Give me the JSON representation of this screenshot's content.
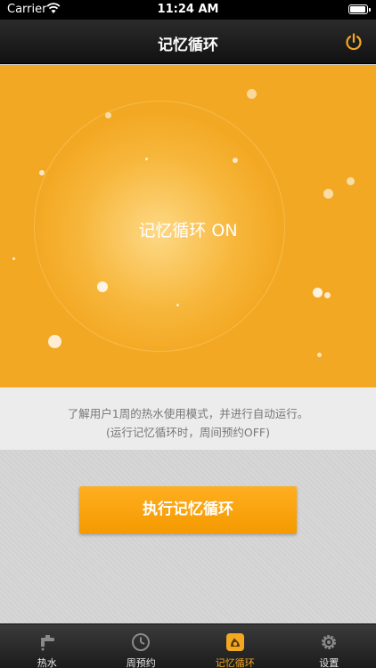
{
  "status_bar": {
    "carrier": "Carrier",
    "time": "11:24 AM"
  },
  "nav": {
    "title": "记忆循环",
    "power_icon": "power-icon"
  },
  "hero": {
    "status": "记忆循环 ON"
  },
  "info": {
    "line1": "了解用户1周的热水使用模式，并进行自动运行。",
    "line2": "(运行记忆循环时，周间预约OFF)"
  },
  "actions": {
    "run_label": "执行记忆循环"
  },
  "tabs": [
    {
      "label": "热水",
      "icon": "faucet-icon",
      "active": false
    },
    {
      "label": "周预约",
      "icon": "clock-icon",
      "active": false
    },
    {
      "label": "记忆循环",
      "icon": "memory-cycle-icon",
      "active": true
    },
    {
      "label": "设置",
      "icon": "gear-icon",
      "active": false
    }
  ],
  "colors": {
    "accent": "#f3a823",
    "button": "#ffa515",
    "nav_bg": "#1f1f1f"
  }
}
